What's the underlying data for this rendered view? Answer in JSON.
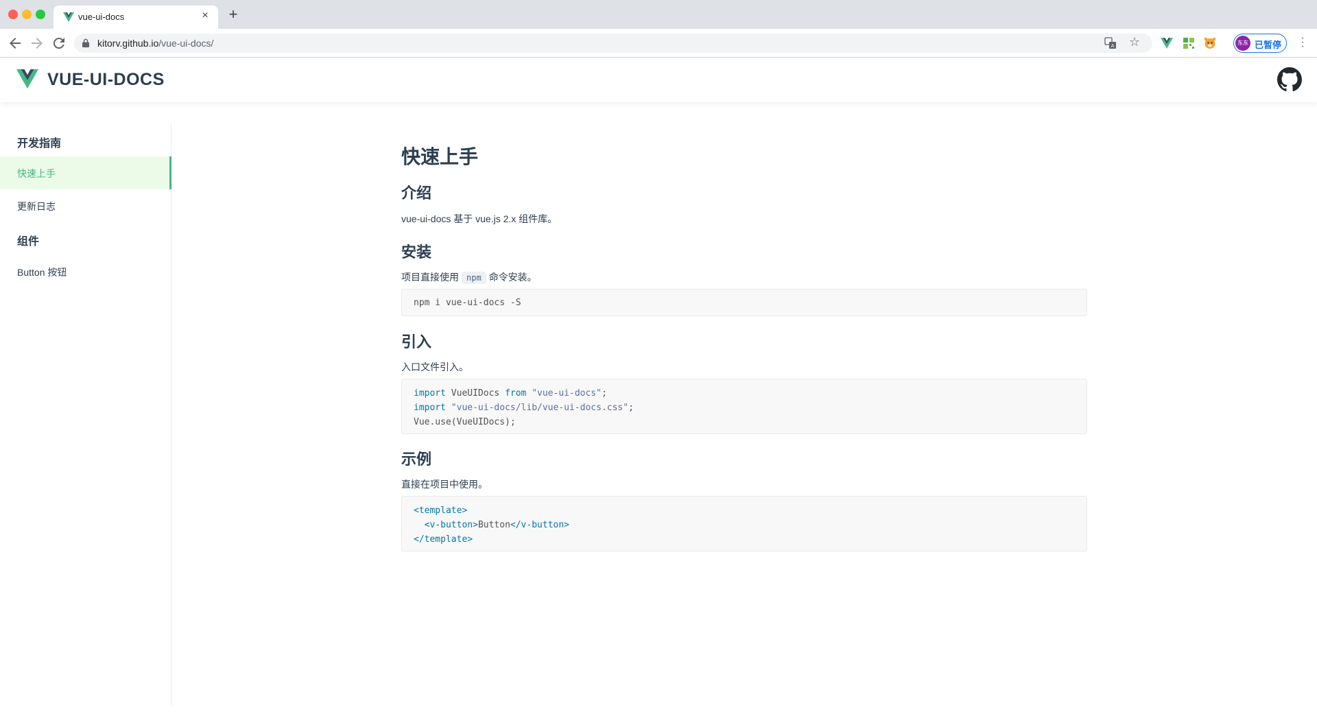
{
  "browser": {
    "tab_title": "vue-ui-docs",
    "new_tab_symbol": "+",
    "close_symbol": "×",
    "url_host": "kitorv.github.io",
    "url_path": "/vue-ui-docs/",
    "profile_avatar_text": "东东",
    "profile_status": "已暂停",
    "icons": [
      "back-arrow-icon",
      "forward-arrow-icon",
      "reload-icon",
      "lock-icon",
      "translate-icon",
      "star-icon",
      "vue-extension-icon",
      "qr-extension-icon",
      "tiger-extension-icon",
      "more-menu-icon"
    ]
  },
  "header": {
    "title": "VUE-UI-DOCS",
    "brand_color": "#42b983"
  },
  "sidebar": {
    "groups": [
      {
        "label": "开发指南"
      },
      {
        "label": "组件"
      }
    ],
    "items": [
      {
        "label": "快速上手",
        "active": true
      },
      {
        "label": "更新日志",
        "active": false
      },
      {
        "label": "Button 按钮",
        "active": false
      }
    ]
  },
  "content": {
    "title": "快速上手",
    "intro": {
      "heading": "介绍",
      "text": "vue-ui-docs 基于 vue.js 2.x 组件库。"
    },
    "install": {
      "heading": "安装",
      "text_before": "项目直接使用",
      "inline_code": "npm",
      "text_after": "命令安装。",
      "code": "npm i vue-ui-docs -S"
    },
    "import": {
      "heading": "引入",
      "text": "入口文件引入。",
      "code_lines": [
        {
          "kw": "import",
          "rest": " VueUIDocs ",
          "kw2": "from",
          "str": " \"vue-ui-docs\"",
          "end": ";"
        },
        {
          "kw": "import",
          "rest": "",
          "kw2": "",
          "str": " \"vue-ui-docs/lib/vue-ui-docs.css\"",
          "end": ";"
        },
        {
          "kw": "",
          "rest": "Vue.use(VueUIDocs);",
          "kw2": "",
          "str": "",
          "end": ""
        }
      ]
    },
    "example": {
      "heading": "示例",
      "text": "直接在项目中使用。",
      "code_lines": [
        {
          "indent": "",
          "open": "<template>",
          "inner": "",
          "close": ""
        },
        {
          "indent": "  ",
          "open": "<v-button>",
          "inner": "Button",
          "close": "</v-button>"
        },
        {
          "indent": "",
          "open": "</template>",
          "inner": "",
          "close": ""
        }
      ]
    }
  }
}
